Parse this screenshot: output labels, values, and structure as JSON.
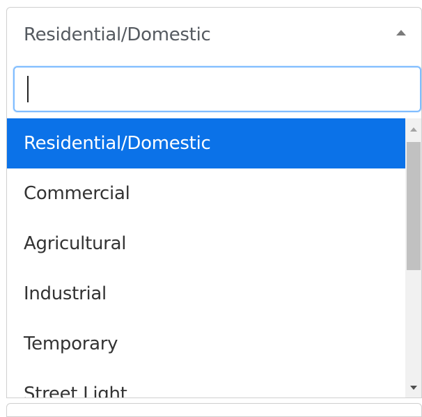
{
  "select": {
    "selected_value": "Residential/Domestic",
    "search_value": ""
  },
  "options": [
    {
      "label": "Residential/Domestic",
      "selected": true
    },
    {
      "label": "Commercial",
      "selected": false
    },
    {
      "label": "Agricultural",
      "selected": false
    },
    {
      "label": "Industrial",
      "selected": false
    },
    {
      "label": "Temporary",
      "selected": false
    },
    {
      "label": "Street Light",
      "selected": false
    }
  ],
  "colors": {
    "selected_bg": "#0b72e8",
    "focus_border": "#80bdff"
  },
  "icons": {
    "dropdown_caret": "caret-up-icon",
    "scroll_up": "scroll-up-arrow-icon",
    "scroll_down": "scroll-down-arrow-icon"
  }
}
